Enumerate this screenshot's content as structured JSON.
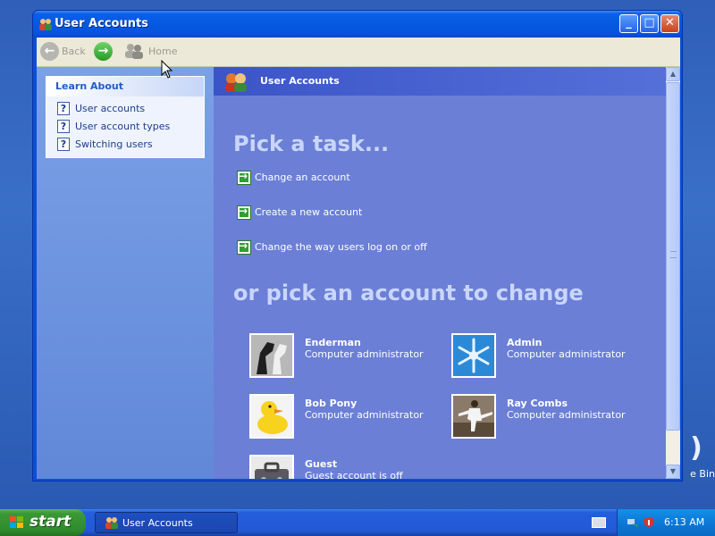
{
  "window": {
    "title": "User Accounts",
    "controls": {
      "minimize": "_",
      "maximize": "□",
      "close": "✕"
    }
  },
  "toolbar": {
    "back_label": "Back",
    "home_label": "Home"
  },
  "sidebar": {
    "heading": "Learn About",
    "items": [
      {
        "label": "User accounts"
      },
      {
        "label": "User account types"
      },
      {
        "label": "Switching users"
      }
    ]
  },
  "main": {
    "header_title": "User Accounts",
    "pick_task_heading": "Pick a task...",
    "tasks": [
      {
        "label": "Change an account"
      },
      {
        "label": "Create a new account"
      },
      {
        "label": "Change the way users log on or off"
      }
    ],
    "pick_account_heading": "or pick an account to change",
    "accounts": [
      {
        "name": "Enderman",
        "role": "Computer administrator",
        "picture": "horse-chess-icon"
      },
      {
        "name": "Admin",
        "role": "Computer administrator",
        "picture": "snowflake-icon"
      },
      {
        "name": "Bob Pony",
        "role": "Computer administrator",
        "picture": "rubber-duck-icon"
      },
      {
        "name": "Ray Combs",
        "role": "Computer administrator",
        "picture": "karate-icon"
      },
      {
        "name": "Guest",
        "role": "Guest account is off",
        "picture": "briefcase-icon"
      }
    ]
  },
  "desktop": {
    "recycle_bin_label": "e Bin"
  },
  "taskbar": {
    "start_label": "start",
    "task_button_label": "User Accounts",
    "clock": "6:13 AM"
  },
  "colors": {
    "title_bar": "#0558e0",
    "main_panel": "#6b7fd6",
    "side_panel": "#7aa1e6",
    "taskbar": "#225ad6",
    "start_button": "#3a9a36"
  }
}
